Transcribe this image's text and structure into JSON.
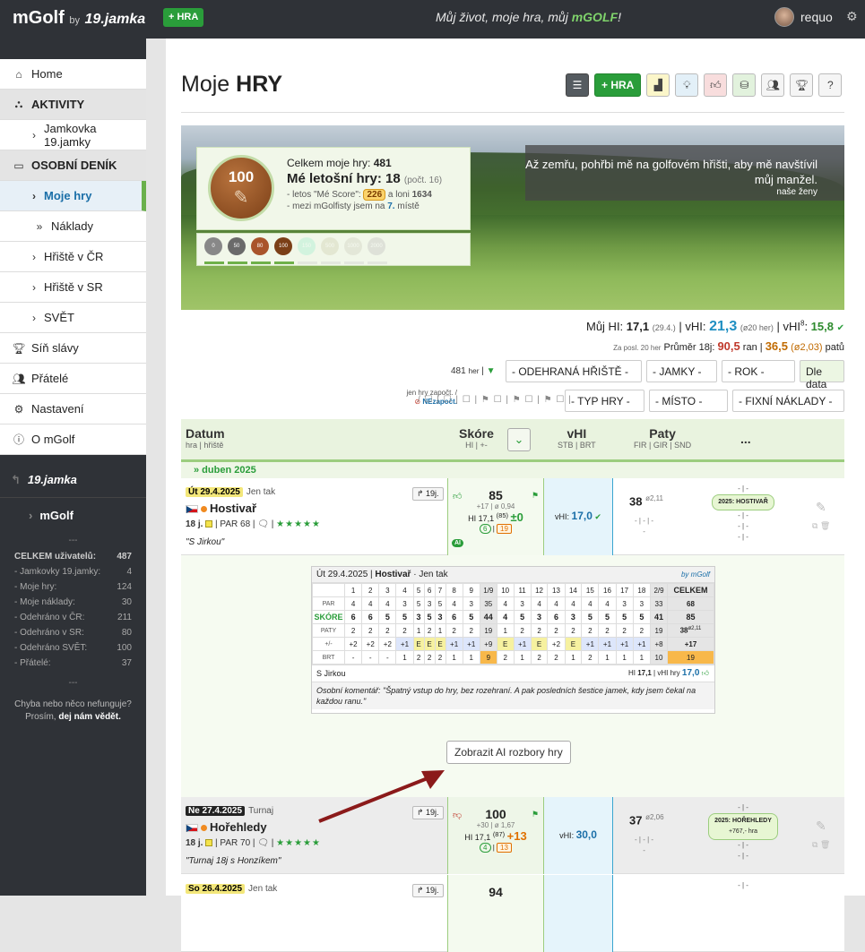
{
  "topbar": {
    "brand": "mGolf",
    "by": "by",
    "partner": "19.jamka",
    "new_game": "HRA",
    "motto_pre": "Můj život, moje hra, můj ",
    "motto_brand": "mGOLF",
    "motto_post": "!",
    "username": "requo"
  },
  "sidebar": {
    "items": [
      {
        "label": "Home",
        "icon": "home-icon"
      },
      {
        "label": "AKTIVITY",
        "icon": "users-icon"
      },
      {
        "label": "Jamkovka 19.jamky"
      },
      {
        "label": "OSOBNÍ DENÍK",
        "icon": "laptop-icon"
      },
      {
        "label": "Moje hry"
      },
      {
        "label": "Náklady"
      },
      {
        "label": "Hřiště v ČR"
      },
      {
        "label": "Hřiště v SR"
      },
      {
        "label": "SVĚT"
      },
      {
        "label": "Síň slávy",
        "icon": "trophy-icon"
      },
      {
        "label": "Přátelé",
        "icon": "friends-icon"
      },
      {
        "label": "Nastavení",
        "icon": "gear-icon"
      },
      {
        "label": "O mGolf",
        "icon": "info-icon"
      }
    ],
    "partner_logo": "19.jamka",
    "mgolf": "mGolf",
    "sep": "---",
    "stats": [
      {
        "label": "CELKEM uživatelů:",
        "value": "487"
      },
      {
        "label": "- Jamkovky 19.jamky:",
        "value": "4"
      },
      {
        "label": "- Moje hry:",
        "value": "124"
      },
      {
        "label": "- Moje náklady:",
        "value": "30"
      },
      {
        "label": "- Odehráno v ČR:",
        "value": "211"
      },
      {
        "label": "- Odehráno v SR:",
        "value": "80"
      },
      {
        "label": "- Odehráno SVĚT:",
        "value": "100"
      },
      {
        "label": "- Přátelé:",
        "value": "37"
      }
    ],
    "bug_line1": "Chyba nebo něco nefunguje?",
    "bug_line2": "Prosím, ",
    "bug_link": "dej nám vědět."
  },
  "main": {
    "title_a": "Moje ",
    "title_b": "HRY",
    "toolbar_hra": "+ HRA",
    "toolbar_help": "?"
  },
  "banner": {
    "total_label": "Celkem moje hry: ",
    "total_value": "481",
    "year_label": "Mé letošní hry: 18",
    "year_note": "(počt. 16)",
    "line3": "- letos \"Mé Score\": ",
    "myscore": "226",
    "line3b": " a loni ",
    "lastyear": "1634",
    "line4": "- mezi mGolfisty jsem na ",
    "rank": "7.",
    "line4b": " místě",
    "medal_value": "100",
    "medals": [
      "0",
      "50",
      "80",
      "100",
      "150",
      "500",
      "1000",
      "2000"
    ],
    "quote": "Až zemřu, pohřbi mě na golfovém hřišti, aby mě navštívil můj manžel.",
    "quote_author": "naše ženy"
  },
  "hi": {
    "my_hi_label": "Můj HI: ",
    "my_hi": "17,1",
    "my_hi_date": "(29.4.)",
    "vhi_label": "vHI: ",
    "vhi": "21,3",
    "vhi_note": "(ø20 her)",
    "vhi8_label": "vHI",
    "vhi8_sup": "8",
    "vhi8": "15,8",
    "avg_note": "Za posl. 20 her",
    "avg_label": " Průměr 18j: ",
    "avg_strokes": "90,5",
    "avg_unit": " ran | ",
    "avg_paty": "36,5",
    "avg_paty_note": "(ø2,03)",
    "avg_paty_unit": " patů"
  },
  "filters": {
    "count": "481",
    "count_unit": "her",
    "played_courses": "- ODEHRANÁ HŘIŠTĚ -",
    "holes": "- JAMKY -",
    "year": "- ROK -",
    "sort": "Dle data",
    "game_type": "- TYP HRY -",
    "place": "- MÍSTO -",
    "fixed_costs": "- FIXNÍ NÁKLADY -",
    "flags_l1": "jen hry započt. /",
    "flags_l2": "NEzapočt.",
    "checkboxes": "/ ☐ | ☐ | ☐ | ⚑ ☐ | ⚑ ☐ | ⚑ ☐ |"
  },
  "table": {
    "h_datum": "Datum",
    "h_datum_sub": "hra | hřiště",
    "h_skore": "Skóre",
    "h_skore_sub": "HI | +-",
    "h_vhi": "vHI",
    "h_vhi_sub": "STB | BRT",
    "h_paty": "Paty",
    "h_paty_sub": "FIR | GIR | SND",
    "h_more": "...",
    "month": "» duben 2025"
  },
  "rows": [
    {
      "date": "Út 29.4.2025",
      "type": "Jen tak",
      "course": "Hostivař",
      "holes": "18 j.",
      "par": "| PAR 68 | ",
      "stars": "★★★★★",
      "comment": "\"S Jirkou\"",
      "share": "↱ 19j.",
      "score": "85",
      "score_sub": "+17 | ø 0,94",
      "hi": "HI 17,1",
      "hi_sup": "(85)",
      "pm": "±0",
      "c1": "6",
      "c2": "19",
      "vhi": "17,0",
      "paty": "38",
      "paty_sub": "ø2,11",
      "paty_l1": "- | - | -",
      "paty_l2": "-",
      "last_l1": "- | -",
      "badge": "2025: HOSTIVAŘ",
      "last_l2": "- | -",
      "last_l3": "- | -",
      "last_l4": "- | -"
    },
    {
      "date": "Ne 27.4.2025",
      "type": "Turnaj",
      "course": "Hořehledy",
      "holes": "18 j.",
      "par": "| PAR 70 | ",
      "stars": "★★★★★",
      "comment": "\"Turnaj 18j s Honzíkem\"",
      "share": "↱ 19j.",
      "score": "100",
      "score_sub": "+30 | ø 1,67",
      "hi": "HI 17,1",
      "hi_sup": "(87)",
      "pm": "+13",
      "c1": "4",
      "c2": "13",
      "vhi": "30,0",
      "paty": "37",
      "paty_sub": "ø2,06",
      "paty_l1": "- | - | -",
      "paty_l2": "-",
      "last_l1": "- | -",
      "badge": "2025: HOŘEHLEDY",
      "badge2": "+767,- hra",
      "last_l2": "- | -",
      "last_l3": "- | -",
      "last_l4": "- | -"
    },
    {
      "date": "So 26.4.2025",
      "type": "Jen tak",
      "share": "↱ 19j.",
      "score": "94",
      "last_l1": "- | -"
    }
  ],
  "scorecard": {
    "header_date": "Út 29.4.2025",
    "header_course": "Hostivař",
    "header_type": "Jen tak",
    "by": "by mGolf",
    "holes": [
      "1",
      "2",
      "3",
      "4",
      "5",
      "6",
      "7",
      "8",
      "9",
      "1/9",
      "10",
      "11",
      "12",
      "13",
      "14",
      "15",
      "16",
      "17",
      "18",
      "2/9",
      "CELKEM"
    ],
    "par": [
      "4",
      "4",
      "4",
      "3",
      "5",
      "3",
      "5",
      "4",
      "3",
      "35",
      "4",
      "3",
      "4",
      "4",
      "4",
      "4",
      "4",
      "3",
      "3",
      "33",
      "68"
    ],
    "skore": [
      "6",
      "6",
      "5",
      "5",
      "3",
      "5",
      "3",
      "6",
      "5",
      "44",
      "4",
      "5",
      "3",
      "6",
      "3",
      "5",
      "5",
      "5",
      "5",
      "41",
      "85"
    ],
    "paty": [
      "2",
      "2",
      "2",
      "2",
      "1",
      "2",
      "1",
      "2",
      "2",
      "19",
      "1",
      "2",
      "2",
      "2",
      "2",
      "2",
      "2",
      "2",
      "2",
      "19",
      "38"
    ],
    "paty_note": "ø2,11",
    "pm": [
      "+2",
      "+2",
      "+2",
      "+1",
      "E",
      "E",
      "E",
      "+1",
      "+1",
      "+9",
      "E",
      "+1",
      "E",
      "+2",
      "E",
      "+1",
      "+1",
      "+1",
      "+1",
      "+8",
      "+17"
    ],
    "brt": [
      "-",
      "-",
      "-",
      "1",
      "2",
      "2",
      "2",
      "1",
      "1",
      "9",
      "2",
      "1",
      "2",
      "2",
      "1",
      "2",
      "1",
      "1",
      "1",
      "10",
      "19"
    ],
    "lbl_par": "PAR",
    "lbl_skore": "SKÓRE",
    "lbl_paty": "PATY",
    "lbl_pm": "+/-",
    "lbl_brt": "BRT",
    "partner": "S Jirkou",
    "hi_label": "HI",
    "hi": "17,1",
    "vhi_label": "vHI hry",
    "vhi": "17,0",
    "note": "Osobní komentář: \"Špatný vstup do hry, bez rozehraní. A pak posledních šestice jamek, kdy jsem čekal na každou ranu.\"",
    "ai_button": "Zobrazit AI rozbory hry"
  }
}
